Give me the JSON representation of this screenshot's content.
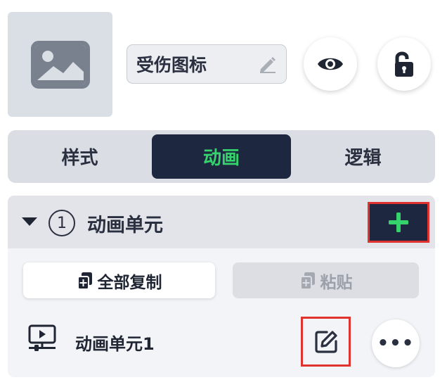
{
  "header": {
    "name_value": "受伤图标"
  },
  "tabs": [
    {
      "label": "样式",
      "active": false
    },
    {
      "label": "动画",
      "active": true
    },
    {
      "label": "逻辑",
      "active": false
    }
  ],
  "animation_group": {
    "index": "1",
    "title": "动画单元",
    "copy_all_label": "全部复制",
    "paste_label": "粘贴",
    "paste_enabled": false,
    "units": [
      {
        "label": "动画单元1"
      }
    ]
  },
  "more_menu_label": "•••",
  "icons": {
    "thumbnail": "image-icon",
    "name_edit": "pencil-icon",
    "visibility": "eye-icon",
    "lock": "unlock-icon",
    "collapse": "caret-down-icon",
    "add": "plus-icon",
    "copy": "copy-icon",
    "paste": "paste-icon",
    "unit": "animation-unit-icon",
    "edit": "edit-icon"
  },
  "colors": {
    "active_tab_bg": "#1e2740",
    "active_tab_text": "#34d36b",
    "add_icon": "#34d36b",
    "highlight_border": "#e0322e"
  }
}
